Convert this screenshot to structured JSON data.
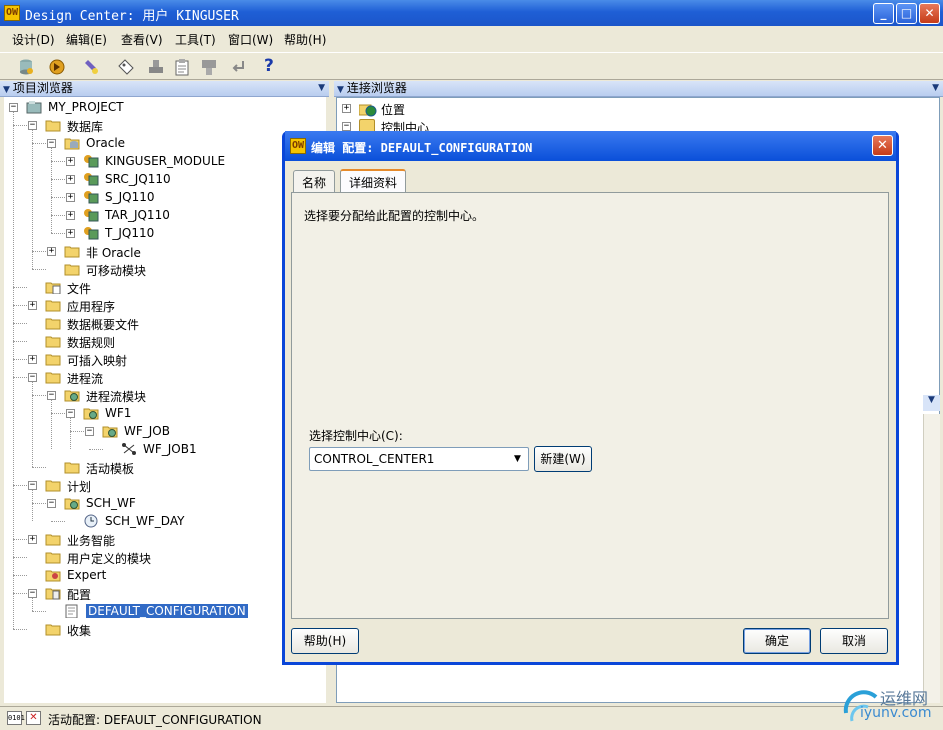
{
  "window": {
    "title": "Design Center: 用户 KINGUSER",
    "min_label": "_",
    "max_label": "□",
    "close_label": "✕"
  },
  "menu": [
    "设计(D)",
    "编辑(E)",
    "查看(V)",
    "工具(T)",
    "窗口(W)",
    "帮助(H)"
  ],
  "toolbar_icons": [
    "database-icon",
    "deploy-icon",
    "flashlight-icon",
    "tag-icon",
    "stamp-icon",
    "clipboard-icon",
    "form-icon",
    "return-icon",
    "help-icon"
  ],
  "toolbar_help": "?",
  "project_pane": {
    "title": "项目浏览器"
  },
  "connection_pane": {
    "title": "连接浏览器",
    "items": [
      "位置",
      "控制中心"
    ]
  },
  "tree": [
    "MY_PROJECT",
    "数据库",
    "Oracle",
    "KINGUSER_MODULE",
    "SRC_JQ110",
    "S_JQ110",
    "TAR_JQ110",
    "T_JQ110",
    "非 Oracle",
    "可移动模块",
    "文件",
    "应用程序",
    "数据概要文件",
    "数据规则",
    "可插入映射",
    "进程流",
    "进程流模块",
    "WF1",
    "WF_JOB",
    "WF_JOB1",
    "活动模板",
    "计划",
    "SCH_WF",
    "SCH_WF_DAY",
    "业务智能",
    "用户定义的模块",
    "Expert",
    "配置",
    "DEFAULT_CONFIGURATION",
    "收集"
  ],
  "dialog": {
    "title": "编辑 配置: DEFAULT_CONFIGURATION",
    "tabs": [
      "名称",
      "详细资料"
    ],
    "instruction": "选择要分配给此配置的控制中心。",
    "select_label": "选择控制中心(C):",
    "select_value": "CONTROL_CENTER1",
    "new_button": "新建(W)",
    "help_button": "帮助(H)",
    "ok_button": "确定",
    "cancel_button": "取消"
  },
  "status": {
    "text": "活动配置: DEFAULT_CONFIGURATION"
  },
  "watermark": {
    "text": "运维网",
    "url_text": "iyunv.com"
  },
  "colors": {
    "title_blue": "#0a46d8",
    "selection": "#316ac5",
    "folder": "#f3d36b"
  }
}
